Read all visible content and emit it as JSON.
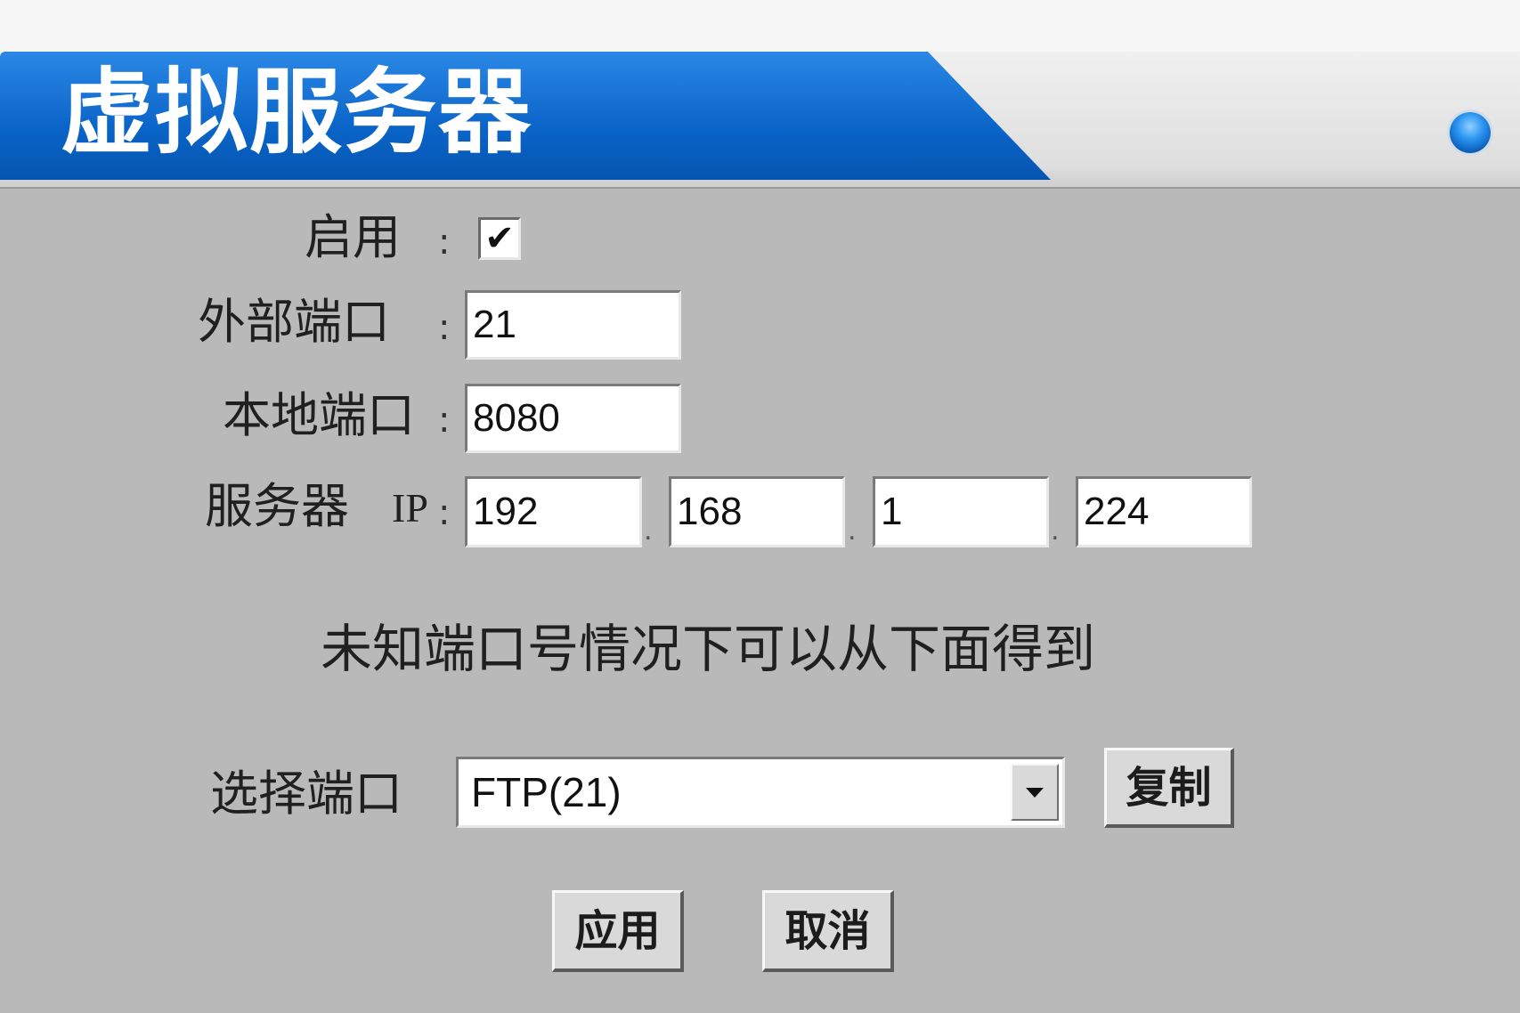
{
  "header": {
    "title": "虚拟服务器"
  },
  "form": {
    "enable": {
      "label": "启用",
      "colon": ":",
      "checked": true,
      "check_glyph": "✔"
    },
    "external_port": {
      "label": "外部端口",
      "colon": ":",
      "value": "21"
    },
    "local_port": {
      "label": "本地端口",
      "colon": ":",
      "value": "8080"
    },
    "server_ip": {
      "label": "服务器",
      "ip_label": "IP",
      "colon": ":",
      "separator": ".",
      "octets": [
        "192",
        "168",
        "1",
        "224"
      ]
    }
  },
  "hint": "未知端口号情况下可以从下面得到",
  "port_select": {
    "label": "选择端口",
    "selected": "FTP(21)",
    "copy_label": "复制"
  },
  "actions": {
    "apply_label": "应用",
    "cancel_label": "取消"
  },
  "colors": {
    "accent": "#0a64c8",
    "background": "#b9b9b9"
  },
  "icons": {
    "status": "status-indicator-icon",
    "checkbox": "check-icon",
    "dropdown": "chevron-down-icon"
  }
}
